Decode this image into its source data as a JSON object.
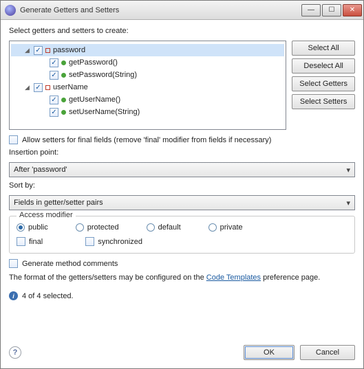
{
  "title": "Generate Getters and Setters",
  "prompt": "Select getters and setters to create:",
  "tree": {
    "password": {
      "label": "password",
      "getter": "getPassword()",
      "setter": "setPassword(String)"
    },
    "userName": {
      "label": "userName",
      "getter": "getUserName()",
      "setter": "setUserName(String)"
    }
  },
  "buttons": {
    "selectAll": "Select All",
    "deselectAll": "Deselect All",
    "selectGetters": "Select Getters",
    "selectSetters": "Select Setters",
    "ok": "OK",
    "cancel": "Cancel"
  },
  "allowFinalSetters": "Allow setters for final fields (remove 'final' modifier from fields if necessary)",
  "insertionPoint": {
    "label": "Insertion point:",
    "value": "After 'password'"
  },
  "sortBy": {
    "label": "Sort by:",
    "value": "Fields in getter/setter pairs"
  },
  "accessModifier": {
    "legend": "Access modifier",
    "public": "public",
    "protected": "protected",
    "default": "default",
    "private": "private",
    "final": "final",
    "synchronized": "synchronized"
  },
  "generateComments": "Generate method comments",
  "formatText": {
    "pre": "The format of the getters/setters may be configured on the ",
    "link": "Code Templates",
    "post": " preference page."
  },
  "status": "4 of 4 selected."
}
